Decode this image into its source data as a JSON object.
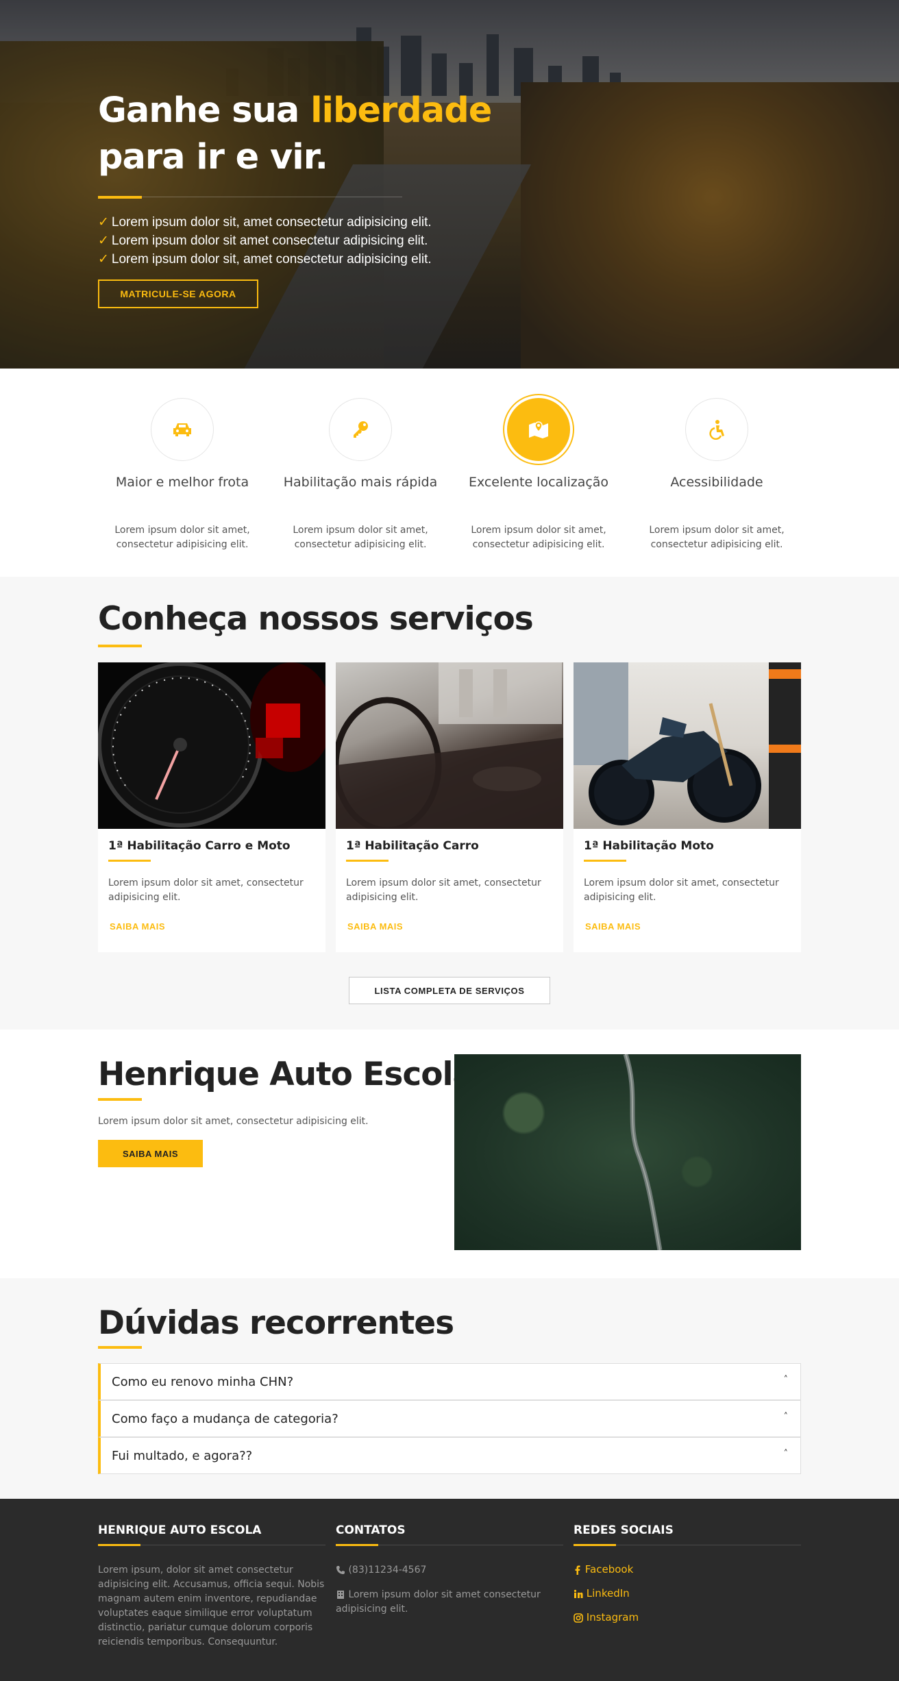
{
  "hero": {
    "title_part1": "Ganhe sua ",
    "title_highlight": "liberdade",
    "title_part2": "para ir e vir.",
    "bullets": [
      "Lorem ipsum dolor sit, amet consectetur adipisicing elit.",
      "Lorem ipsum dolor sit amet consectetur adipisicing elit.",
      "Lorem ipsum dolor sit, amet consectetur adipisicing elit."
    ],
    "check": "✓",
    "cta_label": "MATRICULE-SE AGORA"
  },
  "features": [
    {
      "icon": "car-icon",
      "title": "Maior e melhor frota",
      "desc": "Lorem ipsum dolor sit amet, consectetur adipisicing elit."
    },
    {
      "icon": "key-icon",
      "title": "Habilitação mais rápida",
      "desc": "Lorem ipsum dolor sit amet, consectetur adipisicing elit."
    },
    {
      "icon": "map-location-icon",
      "title": "Excelente localização",
      "desc": "Lorem ipsum dolor sit amet, consectetur adipisicing elit."
    },
    {
      "icon": "accessibility-icon",
      "title": "Acessibilidade",
      "desc": "Lorem ipsum dolor sit amet, consectetur adipisicing elit."
    }
  ],
  "services": {
    "title": "Conheça nossos serviços",
    "cards": [
      {
        "title": "1ª Habilitação Carro e Moto",
        "desc": "Lorem ipsum dolor sit amet, consectetur adipisicing elit.",
        "link": "SAIBA MAIS"
      },
      {
        "title": "1ª Habilitação Carro",
        "desc": "Lorem ipsum dolor sit amet, consectetur adipisicing elit.",
        "link": "SAIBA MAIS"
      },
      {
        "title": "1ª Habilitação Moto",
        "desc": "Lorem ipsum dolor sit amet, consectetur adipisicing elit.",
        "link": "SAIBA MAIS"
      }
    ],
    "button_label": "LISTA COMPLETA DE SERVIÇOS"
  },
  "about": {
    "title": "Henrique Auto Escola",
    "desc": "Lorem ipsum dolor sit amet, consectetur adipisicing elit.",
    "button_label": "SAIBA MAIS"
  },
  "faq": {
    "title": "Dúvidas recorrentes",
    "items": [
      {
        "question": "Como eu renovo minha CHN?",
        "chevron": "˄"
      },
      {
        "question": "Como faço a mudança de categoria?",
        "chevron": "˄"
      },
      {
        "question": "Fui multado, e agora??",
        "chevron": "˄"
      }
    ]
  },
  "footer": {
    "col1": {
      "heading": "HENRIQUE AUTO ESCOLA",
      "text": "Lorem ipsum, dolor sit amet consectetur adipisicing elit. Accusamus, officia sequi. Nobis magnam autem enim inventore, repudiandae voluptates eaque similique error voluptatum distinctio, pariatur cumque dolorum corporis reiciendis temporibus. Consequuntur."
    },
    "col2": {
      "heading": "CONTATOS",
      "phone": "(83)11234-4567",
      "address": "Lorem ipsum dolor sit amet consectetur adipisicing elit."
    },
    "col3": {
      "heading": "REDES SOCIAIS",
      "facebook": "Facebook",
      "linkedin": "LinkedIn",
      "instagram": "Instagram"
    }
  },
  "colors": {
    "accent": "#fcbc10",
    "dark": "#2b2b2b",
    "light_bg": "#f7f7f7"
  }
}
